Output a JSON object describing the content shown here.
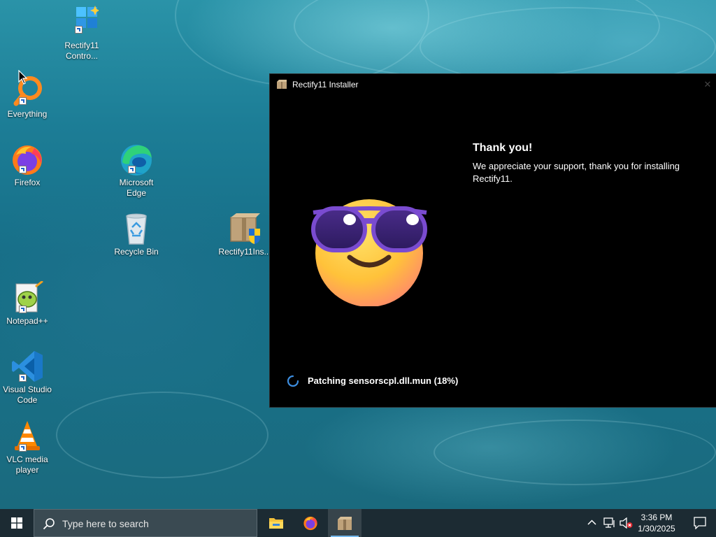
{
  "desktop": {
    "icons": [
      {
        "label": "Rectify11 Contro...",
        "icon": "rectify11-control-icon"
      },
      {
        "label": "Everything",
        "icon": "everything-search-icon"
      },
      {
        "label": "Firefox",
        "icon": "firefox-icon"
      },
      {
        "label": "Microsoft Edge",
        "icon": "edge-icon"
      },
      {
        "label": "Recycle Bin",
        "icon": "recycle-bin-icon"
      },
      {
        "label": "Rectify11Ins...",
        "icon": "rectify11-installer-icon"
      },
      {
        "label": "Notepad++",
        "icon": "notepadpp-icon"
      },
      {
        "label": "Visual Studio Code",
        "icon": "vscode-icon"
      },
      {
        "label": "VLC media player",
        "icon": "vlc-icon"
      }
    ]
  },
  "installer": {
    "title": "Rectify11 Installer",
    "heading": "Thank you!",
    "message": "We appreciate your support, thank you for installing Rectify11.",
    "status": "Patching sensorscpl.dll.mun (18%)",
    "progress_percent": 18,
    "illustration": "sunglasses-emoji"
  },
  "taskbar": {
    "search_placeholder": "Type here to search",
    "pinned": [
      "file-explorer-icon",
      "firefox-icon",
      "rectify11-installer-icon"
    ],
    "active_app": "rectify11-installer-icon",
    "time": "3:36 PM",
    "date": "1/30/2025",
    "tray_icons": [
      "chevron-up-icon",
      "network-icon",
      "volume-muted-icon"
    ]
  },
  "colors": {
    "window_bg": "#000000",
    "taskbar_bg": "#1c2b33",
    "accent": "#76b9ed"
  }
}
